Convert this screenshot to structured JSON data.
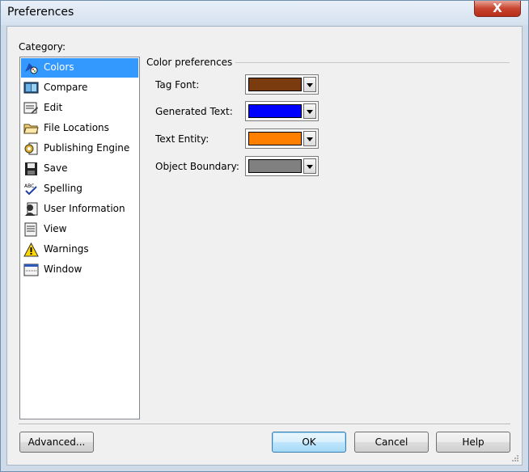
{
  "window": {
    "title": "Preferences",
    "close_glyph": "X"
  },
  "category": {
    "label": "Category:",
    "items": [
      {
        "label": "Colors",
        "icon": "palette-icon",
        "selected": true
      },
      {
        "label": "Compare",
        "icon": "compare-icon",
        "selected": false
      },
      {
        "label": "Edit",
        "icon": "edit-icon",
        "selected": false
      },
      {
        "label": "File Locations",
        "icon": "folder-icon",
        "selected": false
      },
      {
        "label": "Publishing Engine",
        "icon": "gear-document-icon",
        "selected": false
      },
      {
        "label": "Save",
        "icon": "floppy-disk-icon",
        "selected": false
      },
      {
        "label": "Spelling",
        "icon": "spellcheck-icon",
        "selected": false
      },
      {
        "label": "User Information",
        "icon": "user-icon",
        "selected": false
      },
      {
        "label": "View",
        "icon": "view-document-icon",
        "selected": false
      },
      {
        "label": "Warnings",
        "icon": "warning-icon",
        "selected": false
      },
      {
        "label": "Window",
        "icon": "window-icon",
        "selected": false
      }
    ]
  },
  "color_prefs": {
    "title": "Color preferences",
    "rows": [
      {
        "label": "Tag Font:",
        "color": "#7a3c0e"
      },
      {
        "label": "Generated Text:",
        "color": "#0000ff"
      },
      {
        "label": "Text Entity:",
        "color": "#ff8000"
      },
      {
        "label": "Object Boundary:",
        "color": "#808080"
      }
    ]
  },
  "buttons": {
    "advanced": "Advanced...",
    "ok": "OK",
    "cancel": "Cancel",
    "help": "Help"
  },
  "colors": {
    "selection": "#3399ff",
    "close_button": "#c8442f"
  }
}
